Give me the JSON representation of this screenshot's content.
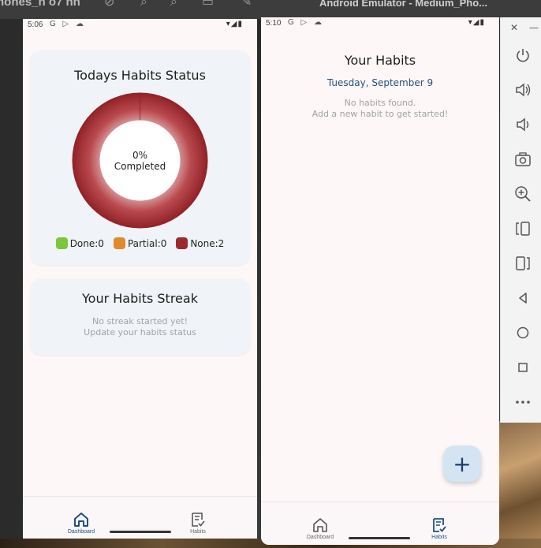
{
  "desktop": {
    "left_window_title": "hones_n o7 hh",
    "emulator_window_title": "Android Emulator - Medium_Pho..."
  },
  "left_phone": {
    "status_time": "5:06",
    "status_icons": "G ▷ ☁",
    "status_card": {
      "title": "Todays Habits Status",
      "center_percent": "0%",
      "center_label": "Completed",
      "legend": [
        {
          "label": "Done:0",
          "color": "#7cc63c"
        },
        {
          "label": "Partial:0",
          "color": "#e08a2e"
        },
        {
          "label": "None:2",
          "color": "#9b2a2f"
        }
      ]
    },
    "streak_card": {
      "title": "Your Habits Streak",
      "line1": "No streak started yet!",
      "line2": "Update your habits status"
    },
    "nav": {
      "dashboard": "Dashboard",
      "habits": "Habits",
      "active": "dashboard"
    }
  },
  "right_phone": {
    "status_time": "5:10",
    "status_icons": "G ▷ ☁",
    "title": "Your Habits",
    "date": "Tuesday, September 9",
    "empty_line1": "No habits found.",
    "empty_line2": "Add a new habit to get started!",
    "fab_label": "+",
    "nav": {
      "dashboard": "Dashboard",
      "habits": "Habits",
      "active": "habits"
    }
  },
  "emulator_controls": [
    "power",
    "volume-up",
    "volume-down",
    "camera",
    "zoom",
    "rotate-left",
    "rotate-right",
    "back",
    "home",
    "overview",
    "more"
  ],
  "colors": {
    "accent": "#1f4f86",
    "none_red": "#9b2a2f",
    "card_bg": "#f0f3f7",
    "screen_bg": "#fdf7f8"
  }
}
